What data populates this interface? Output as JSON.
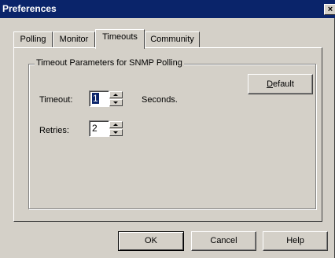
{
  "window": {
    "title": "Preferences",
    "close_glyph": "×"
  },
  "tabs": [
    {
      "label": "Polling"
    },
    {
      "label": "Monitor"
    },
    {
      "label": "Timeouts",
      "active": true
    },
    {
      "label": "Community"
    }
  ],
  "group": {
    "title": "Timeout Parameters for SNMP Polling"
  },
  "default_button": {
    "accel": "D",
    "rest": "efault"
  },
  "timeout": {
    "label": "Timeout:",
    "value": "1",
    "unit": "Seconds."
  },
  "retries": {
    "label": "Retries:",
    "value": "2"
  },
  "footer": {
    "ok": "OK",
    "cancel": "Cancel",
    "help": "Help"
  },
  "colors": {
    "titlebar": "#0a246a",
    "face": "#d4d0c8"
  }
}
